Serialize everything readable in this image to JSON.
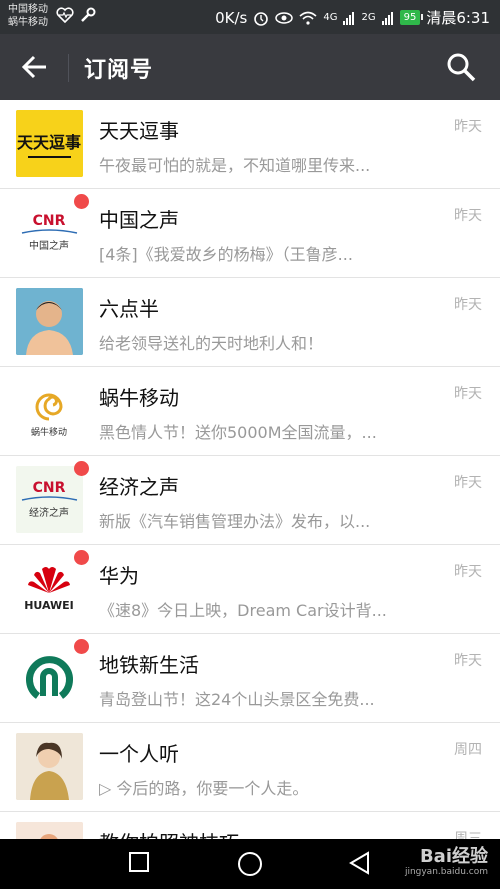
{
  "status_bar": {
    "carrier_1": "中国移动",
    "carrier_2": "蜗牛移动",
    "speed": "0K/s",
    "signal_1": "4G",
    "signal_2": "2G",
    "battery": "95",
    "time": "清晨6:31"
  },
  "header": {
    "title": "订阅号"
  },
  "subscriptions": [
    {
      "name": "天天逗事",
      "preview": "午夜最可怕的就是，不知道哪里传来...",
      "time": "昨天",
      "unread": false,
      "avatar_text": "天天逗事"
    },
    {
      "name": "中国之声",
      "preview": "[4条]《我爱故乡的杨梅》（王鲁彦...",
      "time": "昨天",
      "unread": true,
      "avatar_text": "CNR",
      "avatar_sub": "中国之声"
    },
    {
      "name": "六点半",
      "preview": "给老领导送礼的天时地利人和！",
      "time": "昨天",
      "unread": false
    },
    {
      "name": "蜗牛移动",
      "preview": "黑色情人节！送你5000M全国流量，...",
      "time": "昨天",
      "unread": false,
      "avatar_text": "蜗牛移动"
    },
    {
      "name": "经济之声",
      "preview": "新版《汽车销售管理办法》发布，以...",
      "time": "昨天",
      "unread": true,
      "avatar_text": "CNR",
      "avatar_sub": "经济之声"
    },
    {
      "name": "华为",
      "preview": "《速8》今日上映，Dream Car设计背...",
      "time": "昨天",
      "unread": true,
      "avatar_text": "HUAWEI"
    },
    {
      "name": "地铁新生活",
      "preview": "青岛登山节！这24个山头景区全免费...",
      "time": "昨天",
      "unread": true
    },
    {
      "name": "一个人听",
      "preview": "▷ 今后的路，你要一个人走。",
      "time": "周四",
      "unread": false
    },
    {
      "name": "教你拍照神技巧",
      "preview": "",
      "time": "周三",
      "unread": false
    }
  ],
  "watermark": {
    "brand": "Bai经验",
    "url": "jingyan.baidu.com"
  }
}
